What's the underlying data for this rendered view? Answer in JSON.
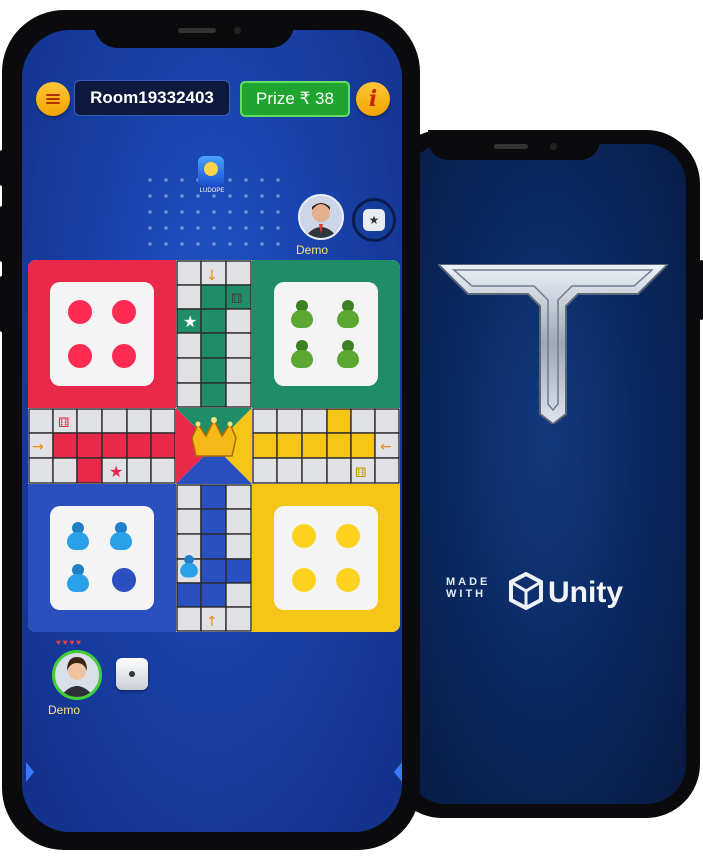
{
  "game": {
    "room_label": "Room19332403",
    "prize_label": "Prize ₹ 38",
    "top_player_name": "Demo",
    "bottom_player_name": "Demo",
    "logo_caption": "LUDOPE",
    "bottom_player_lives": 4
  },
  "splash": {
    "made_with_line1": "MADE",
    "made_with_line2": "WITH",
    "engine_name": "Unity"
  },
  "colors": {
    "red": "#e8294a",
    "green": "#1f8e68",
    "yellow": "#f5c518",
    "blue": "#2a4fbf",
    "prize_green": "#1fa52f",
    "player_name": "#ffe27a"
  },
  "icons": [
    "menu-icon",
    "info-icon",
    "star-icon",
    "dice-icon",
    "crown-icon",
    "unity-logo-icon"
  ]
}
